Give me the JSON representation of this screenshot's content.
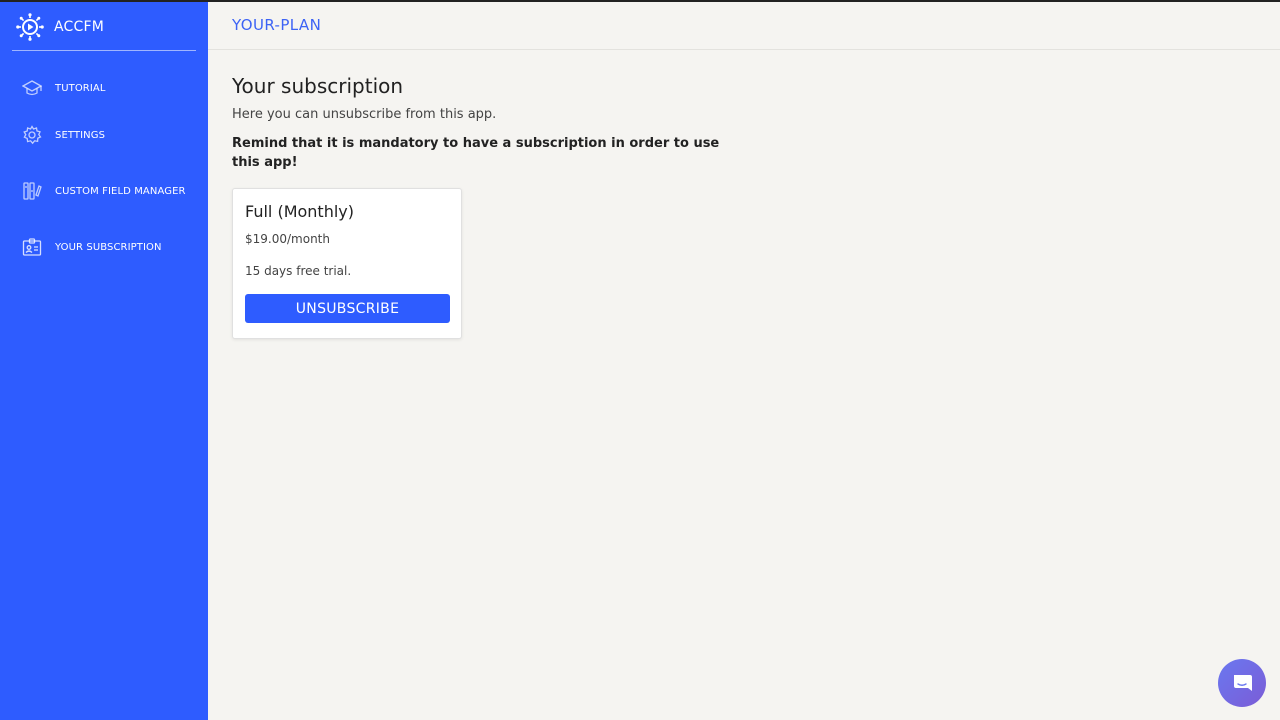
{
  "app": {
    "name": "ACCFM"
  },
  "sidebar": {
    "items": [
      {
        "label": "TUTORIAL",
        "icon": "graduation-cap-icon"
      },
      {
        "label": "SETTINGS",
        "icon": "gear-icon"
      },
      {
        "label": "CUSTOM FIELD MANAGER",
        "icon": "field-manager-icon"
      },
      {
        "label": "YOUR SUBSCRIPTION",
        "icon": "id-card-icon"
      }
    ]
  },
  "header": {
    "title": "YOUR-PLAN"
  },
  "main": {
    "title": "Your subscription",
    "subtitle": "Here you can unsubscribe from this app.",
    "reminder": "Remind that it is mandatory to have a subscription in order to use this app!"
  },
  "plan": {
    "name": "Full (Monthly)",
    "price": "$19.00/month",
    "trial": "15 days free trial.",
    "button_label": "UNSUBSCRIBE"
  },
  "chat": {
    "icon": "chat-bubble-icon"
  },
  "colors": {
    "sidebar": "#2e5cff",
    "accent": "#3d63f5",
    "background": "#f5f4f1",
    "chat": "#6a78f0"
  }
}
